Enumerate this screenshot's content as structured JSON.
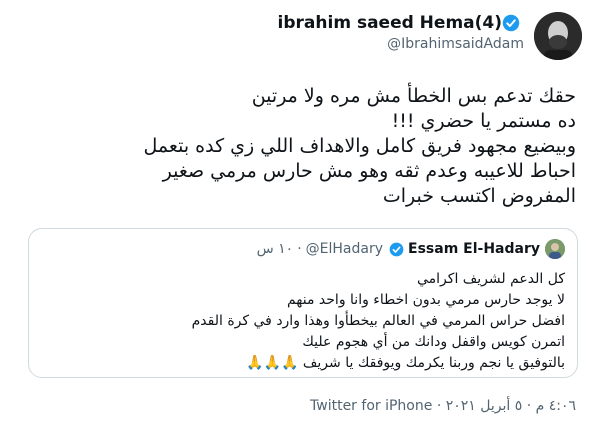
{
  "author": {
    "display_name": "ibrahim saeed Hema(4)",
    "handle": "@IbrahimsaidAdam",
    "verified_icon": "verified-badge-icon"
  },
  "tweet_lines": [
    "حقك تدعم بس الخطأ مش مره ولا مرتين",
    "ده مستمر يا حضري !!!",
    "وبيضيع مجهود فريق كامل والاهداف اللي زي كده بتعمل",
    "احباط للاعيبه وعدم ثقه وهو مش حارس مرمي صغير",
    "المفروض اكتسب خبرات"
  ],
  "quoted": {
    "display_name": "Essam El-Hadary",
    "handle": "@ElHadary",
    "time": "١٠ س",
    "separator": "·",
    "lines": [
      "كل الدعم لشريف اكرامي",
      "لا يوجد حارس مرمي بدون اخطاء وانا واحد منهم",
      "افضل حراس المرمي في العالم بيخطأوا وهذا وارد في كرة القدم",
      "اتمرن كويس واقفل ودانك من أي هجوم عليك",
      "بالتوفيق يا نجم وربنا يكرمك ويوفقك يا شريف"
    ],
    "emoji": "🙏🙏🙏"
  },
  "meta": {
    "timestamp": "٤:٠٦ م · ٥ أبريل ٢٠٢١",
    "separator": "·",
    "source": "Twitter for iPhone"
  },
  "colors": {
    "verified_blue": "#1d9bf0",
    "secondary_text": "#536471",
    "border": "#cfd9de"
  }
}
